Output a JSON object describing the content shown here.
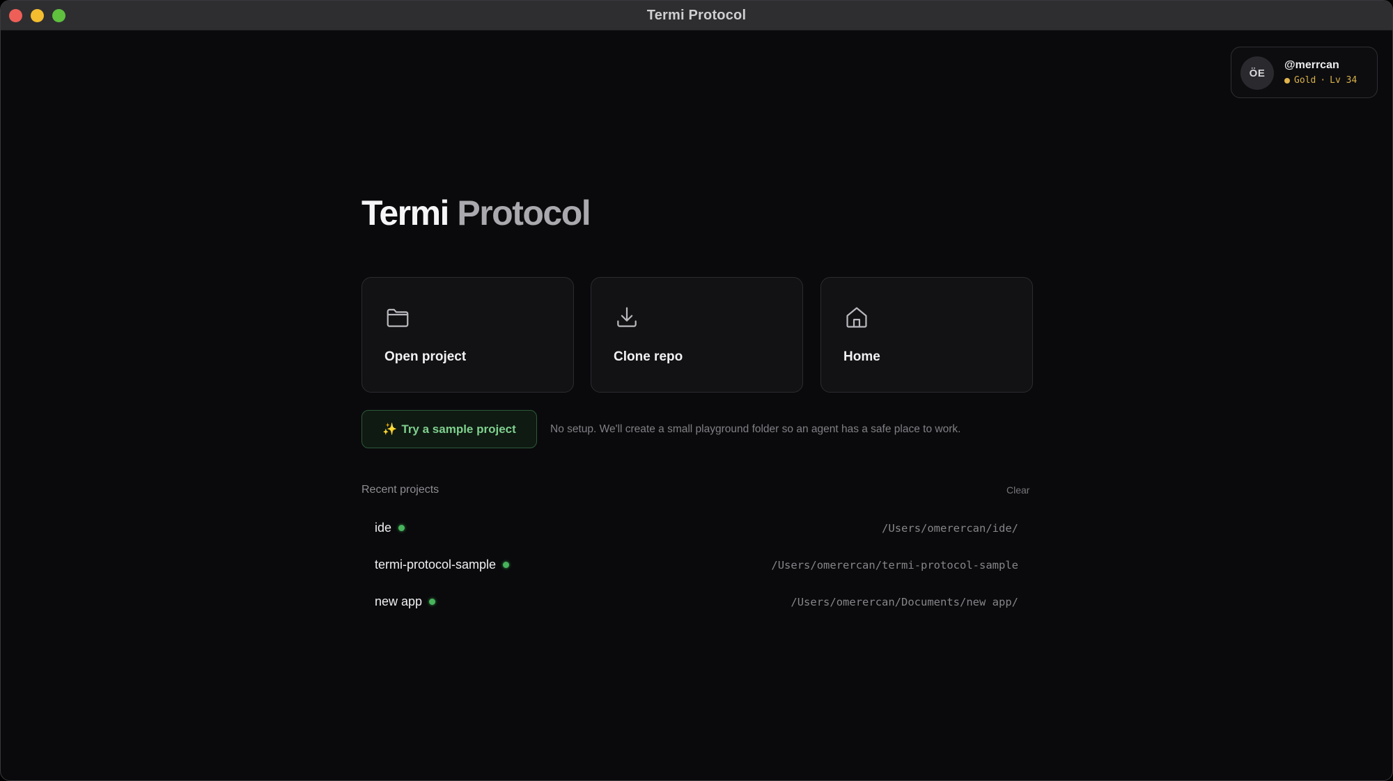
{
  "window": {
    "title": "Termi Protocol"
  },
  "user": {
    "initials": "ÖE",
    "handle": "@merrcan",
    "tier": "Gold",
    "separator": "·",
    "level": "Lv 34",
    "tier_color": "#e2b44b"
  },
  "hero": {
    "title_part1": "Termi",
    "title_part2": "Protocol"
  },
  "actions": [
    {
      "label": "Open project",
      "icon": "folder-icon"
    },
    {
      "label": "Clone repo",
      "icon": "download-icon"
    },
    {
      "label": "Home",
      "icon": "home-icon"
    }
  ],
  "sample": {
    "icon": "✨",
    "label": "Try a sample project",
    "note": "No setup. We'll create a small playground folder so an agent has a safe place to work."
  },
  "recent": {
    "label": "Recent projects",
    "clear_label": "Clear",
    "items": [
      {
        "name": "ide",
        "path": "/Users/omerercan/ide/",
        "status_color": "#47b45c"
      },
      {
        "name": "termi-protocol-sample",
        "path": "/Users/omerercan/termi-protocol-sample",
        "status_color": "#47b45c"
      },
      {
        "name": "new app",
        "path": "/Users/omerercan/Documents/new app/",
        "status_color": "#47b45c"
      }
    ]
  },
  "colors": {
    "accent_green": "#7fd08e",
    "background": "#0a0a0c",
    "card": "#121215"
  }
}
